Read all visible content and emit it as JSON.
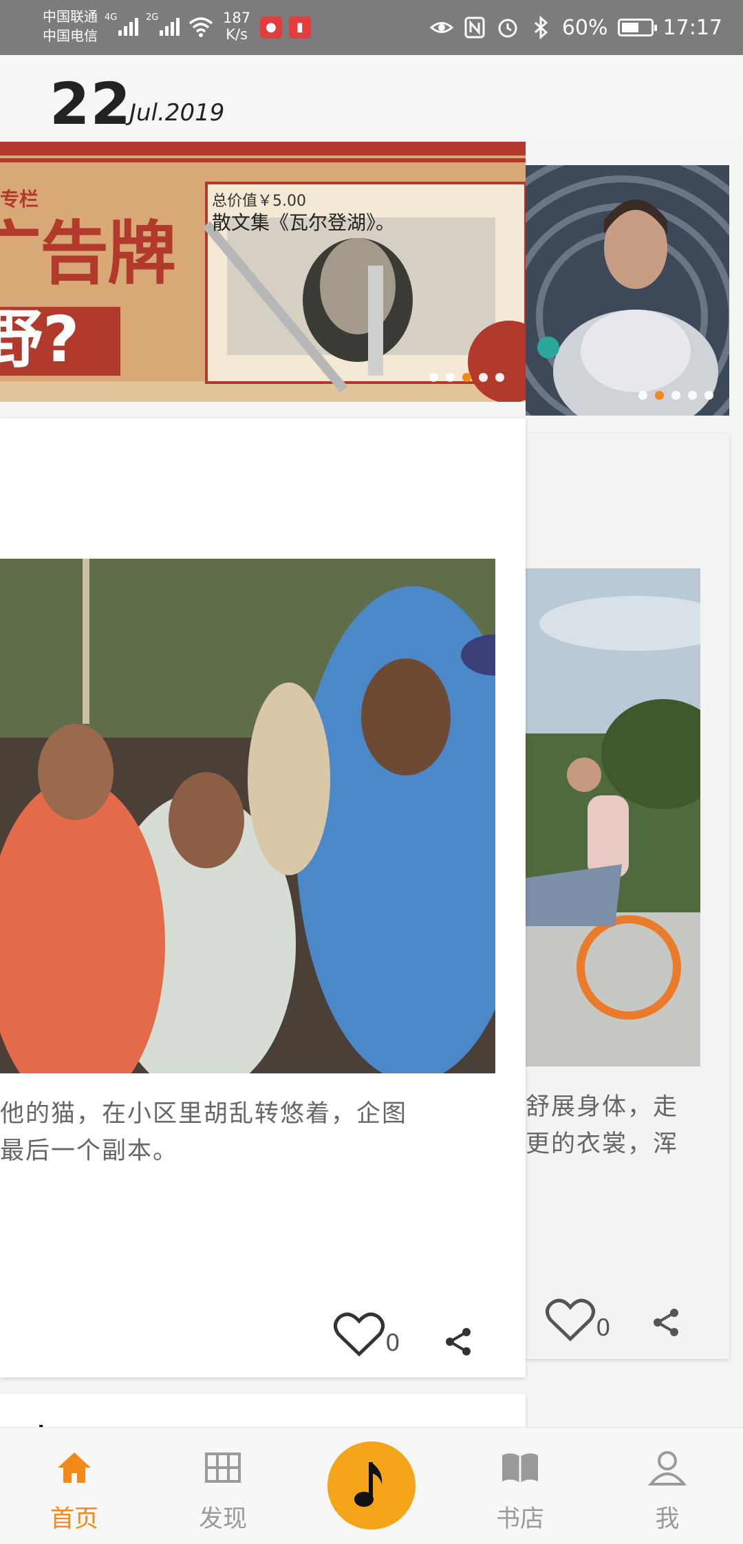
{
  "status_bar": {
    "carrier_1": "中国联通",
    "carrier_2": "中国电信",
    "network_1": "4G",
    "network_2": "2G",
    "speed_value": "187",
    "speed_unit": "K/s",
    "battery": "60%",
    "battery_level": 0.6,
    "time": "17:17",
    "icons": [
      "signal-icon",
      "wifi-icon",
      "mic-app-icon",
      "book-app-icon",
      "eye-icon",
      "nfc-icon",
      "alarm-icon",
      "bluetooth-icon",
      "battery-icon"
    ]
  },
  "header": {
    "day": "22",
    "month_year": "Jul.2019"
  },
  "main": {
    "banner": {
      "column_tag": "专栏",
      "headline_1": "广告牌",
      "headline_2": "野?",
      "caption_1": "总价值￥5.00",
      "caption_2": "散文集《瓦尔登湖》。",
      "dots_count": 5,
      "active_dot": 2
    },
    "right_banner": {
      "dots_count": 5,
      "active_dot": 1
    },
    "card": {
      "excerpt_line_1": "他的猫，在小区里胡乱转悠着，企图",
      "excerpt_line_2": "最后一个副本。",
      "like_count": "0",
      "next_title": "一杯"
    },
    "right_card": {
      "excerpt_line_1": "舒展身体，走",
      "excerpt_line_2": "更的衣裳，浑",
      "like_count": "0"
    }
  },
  "nav": {
    "tabs": [
      {
        "label": "首页",
        "icon": "home-icon",
        "active": true
      },
      {
        "label": "发现",
        "icon": "grid-icon",
        "active": false
      },
      {
        "label": "书店",
        "icon": "book-icon",
        "active": false
      },
      {
        "label": "我",
        "icon": "user-icon",
        "active": false
      }
    ],
    "player_icon": "music-note-icon"
  },
  "colors": {
    "accent": "#f28a1a",
    "player": "#f4a418",
    "status_bar": "#7c7c7c",
    "header_bg": "#f8f6f5"
  }
}
